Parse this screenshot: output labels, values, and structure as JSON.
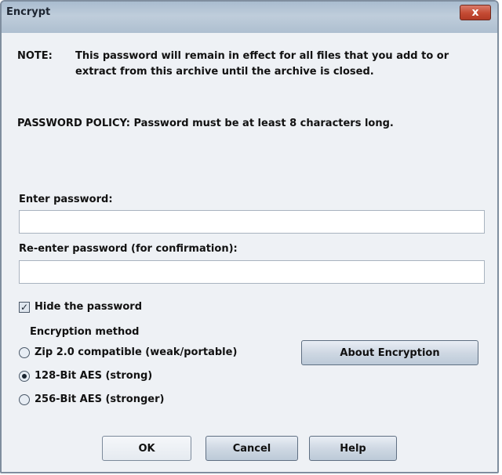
{
  "window": {
    "title": "Encrypt",
    "close_glyph": "x"
  },
  "note": {
    "label": "NOTE:",
    "text": "This password will remain in effect for all files that you add to or extract from this archive until the archive is closed."
  },
  "policy": "PASSWORD POLICY: Password must be at least 8 characters long.",
  "password": {
    "label": "Enter password:",
    "value": "",
    "confirm_label": "Re-enter password (for confirmation):",
    "confirm_value": ""
  },
  "hide_password": {
    "label": "Hide the password",
    "checked": true,
    "check_glyph": "✓"
  },
  "encryption": {
    "title": "Encryption method",
    "options": [
      {
        "label": "Zip 2.0 compatible (weak/portable)",
        "selected": false
      },
      {
        "label": "128-Bit AES (strong)",
        "selected": true
      },
      {
        "label": "256-Bit AES (stronger)",
        "selected": false
      }
    ],
    "about_button": "About Encryption"
  },
  "buttons": {
    "ok": "OK",
    "cancel": "Cancel",
    "help": "Help"
  }
}
